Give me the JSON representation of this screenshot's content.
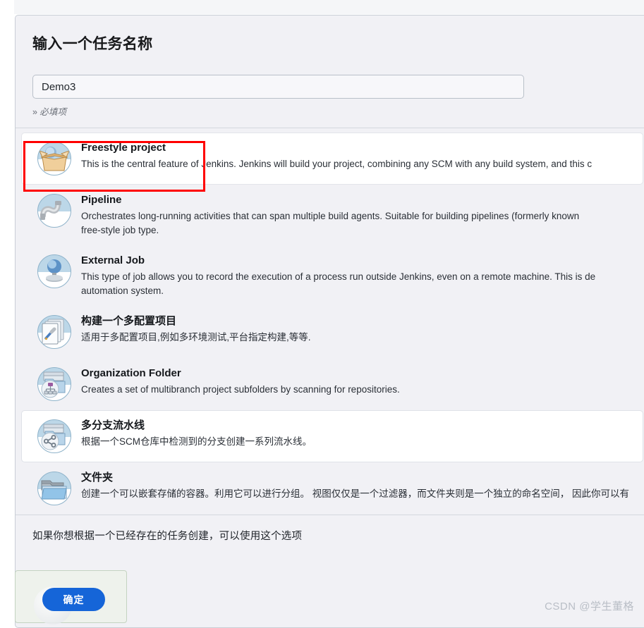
{
  "page": {
    "title": "输入一个任务名称",
    "watermark": "CSDN @学生董格"
  },
  "name_field": {
    "value": "Demo3",
    "placeholder": "",
    "required_note": "必填项",
    "required_chevron": "»"
  },
  "items": [
    {
      "icon": "freestyle-box-icon",
      "title": "Freestyle project",
      "desc": "This is the central feature of Jenkins. Jenkins will build your project, combining any SCM with any build system, and this c",
      "selected": true,
      "nowrap": true
    },
    {
      "icon": "pipeline-icon",
      "title": "Pipeline",
      "desc": "Orchestrates long-running activities that can span multiple build agents. Suitable for building pipelines (formerly known\nfree-style job type.",
      "selected": false,
      "nowrap": false
    },
    {
      "icon": "external-job-icon",
      "title": "External Job",
      "desc": "This type of job allows you to record the execution of a process run outside Jenkins, even on a remote machine. This is de\nautomation system.",
      "selected": false,
      "nowrap": false
    },
    {
      "icon": "multi-configuration-icon",
      "title": "构建一个多配置项目",
      "desc": "适用于多配置项目,例如多环境测试,平台指定构建,等等.",
      "selected": false,
      "nowrap": true
    },
    {
      "icon": "organization-folder-icon",
      "title": "Organization Folder",
      "desc": "Creates a set of multibranch project subfolders by scanning for repositories.",
      "selected": false,
      "nowrap": true
    },
    {
      "icon": "multibranch-pipeline-icon",
      "title": "多分支流水线",
      "desc": "根据一个SCM仓库中检测到的分支创建一系列流水线。",
      "selected": false,
      "nowrap": true,
      "card": true
    },
    {
      "icon": "folder-icon",
      "title": "文件夹",
      "desc": "创建一个可以嵌套存储的容器。利用它可以进行分组。 视图仅仅是一个过滤器，而文件夹则是一个独立的命名空间， 因此你可以有",
      "selected": false,
      "nowrap": true
    }
  ],
  "footer": {
    "copy_note": "如果你想根据一个已经存在的任务创建，可以使用这个选项"
  },
  "overlay": {
    "confirm_label": "确定"
  }
}
